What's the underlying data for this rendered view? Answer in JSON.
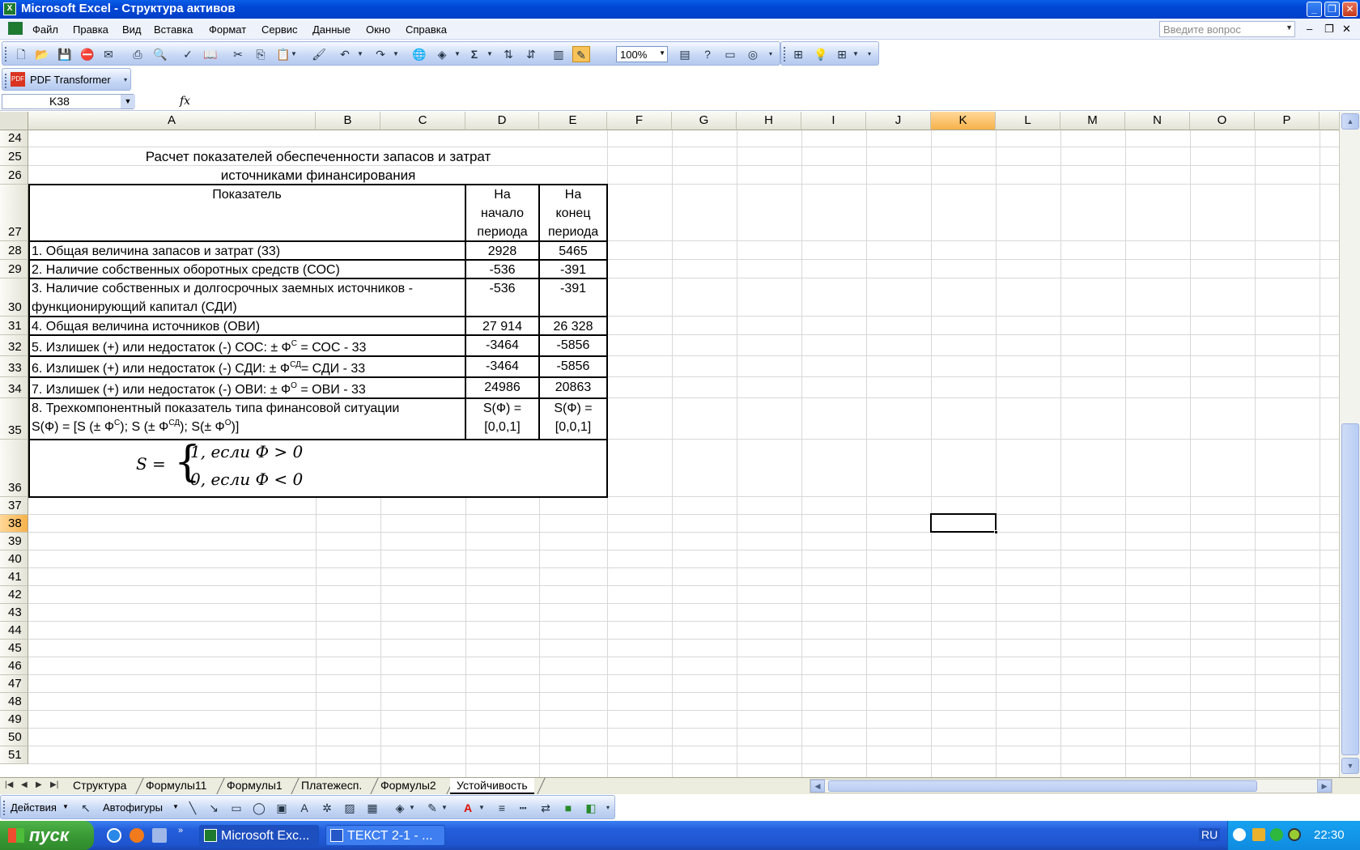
{
  "window": {
    "title": "Microsoft Excel - Структура активов"
  },
  "menu": {
    "items": [
      "Файл",
      "Правка",
      "Вид",
      "Вставка",
      "Формат",
      "Сервис",
      "Данные",
      "Окно",
      "Справка"
    ],
    "ask_placeholder": "Введите вопрос"
  },
  "toolbar": {
    "zoom": "100%",
    "pdf_label": "PDF Transformer"
  },
  "namebox": {
    "value": "K38"
  },
  "formula": {
    "fx_label": "fx",
    "value": ""
  },
  "sheet": {
    "columns": [
      "A",
      "B",
      "C",
      "D",
      "E",
      "F",
      "G",
      "H",
      "I",
      "J",
      "K",
      "L",
      "M",
      "N",
      "O",
      "P"
    ],
    "active_column": "K",
    "rows": [
      "24",
      "25",
      "26",
      "27",
      "28",
      "29",
      "30",
      "31",
      "32",
      "33",
      "34",
      "35",
      "36",
      "37",
      "38",
      "39",
      "40",
      "41",
      "42",
      "43",
      "44",
      "45",
      "46",
      "47",
      "48",
      "49",
      "50",
      "51"
    ],
    "active_row": "38",
    "title_line1": "Расчет показателей обеспеченности запасов и затрат",
    "title_line2": "источниками финансирования",
    "header": {
      "indicator": "Показатель",
      "start": "На начало периода",
      "end": "На конец периода"
    },
    "table_rows": [
      {
        "label": "1. Общая величина запасов и затрат (33)",
        "start": "2928",
        "end": "5465"
      },
      {
        "label": "2. Наличие     собственных     оборотных средств (СОС)",
        "start": "-536",
        "end": "-391"
      },
      {
        "label_line1": "3. Наличие собственных и долгосрочных заемных источников -",
        "label_line2": "функционирующий капитал (СДИ)",
        "start": "-536",
        "end": "-391"
      },
      {
        "label": "4. Общая величина источников (ОВИ)",
        "start": "27 914",
        "end": "26 328"
      },
      {
        "label_pre": "5. Излишек (+) или недостаток (-) СОС:    ± Ф",
        "label_sup": "С",
        "label_post": "  = СОС - 33",
        "start": "-3464",
        "end": "-5856"
      },
      {
        "label_pre": "6. Излишек (+) или недостаток (-) СДИ:    ± Ф",
        "label_sup": "СД",
        "label_post": "= СДИ - 33",
        "start": "-3464",
        "end": "-5856"
      },
      {
        "label_pre": "7. Излишек (+) или недостаток (-) ОВИ:    ± Ф",
        "label_sup": "О",
        "label_post": "  = ОВИ - 33",
        "start": "24986",
        "end": "20863"
      },
      {
        "label_line1": "8. Трехкомпонентный   показатель   типа финансовой ситуации",
        "l2_a": "S(Ф) = [S (± Ф",
        "l2_sup1": "С",
        "l2_b": "); S (± Ф",
        "l2_sup2": "СД",
        "l2_c": "); S(± Ф",
        "l2_sup3": "О",
        "l2_d": ")]",
        "start_line1": "S(Ф) =",
        "start_line2": "[0,0,1]",
        "end_line1": "S(Ф) =",
        "end_line2": "[0,0,1]"
      }
    ],
    "formula_image": {
      "lhs": "S =",
      "case1": "1,   если   Ф > 0",
      "case2": "0,   если   Ф < 0"
    }
  },
  "tabs": [
    "Структура",
    "Формулы11",
    "Формулы1",
    "Платежесп.",
    "Формулы2",
    "Устойчивость"
  ],
  "active_tab": "Устойчивость",
  "drawbar": {
    "actions": "Действия",
    "autoshapes": "Автофигуры"
  },
  "taskbar": {
    "start": "пуск",
    "items": [
      "Microsoft Exc...",
      "ТЕКСТ 2-1 - ..."
    ],
    "lang": "RU",
    "clock": "22:30"
  }
}
